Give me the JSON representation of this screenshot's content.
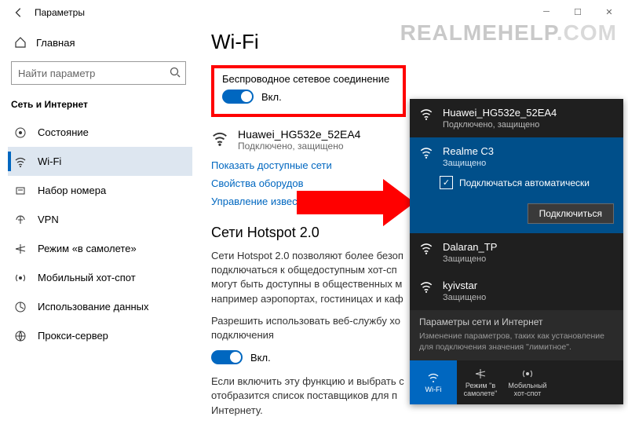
{
  "window": {
    "title": "Параметры"
  },
  "watermark": {
    "a": "REALMEHELP",
    "b": ".COM"
  },
  "sidebar": {
    "home": "Главная",
    "search_placeholder": "Найти параметр",
    "category": "Сеть и Интернет",
    "items": [
      {
        "label": "Состояние"
      },
      {
        "label": "Wi-Fi"
      },
      {
        "label": "Набор номера"
      },
      {
        "label": "VPN"
      },
      {
        "label": "Режим «в самолете»"
      },
      {
        "label": "Мобильный хот-спот"
      },
      {
        "label": "Использование данных"
      },
      {
        "label": "Прокси-сервер"
      }
    ]
  },
  "main": {
    "heading": "Wi-Fi",
    "wireless_label": "Беспроводное сетевое соединение",
    "toggle_state": "Вкл.",
    "current": {
      "name": "Huawei_HG532e_52EA4",
      "status": "Подключено, защищено"
    },
    "links": {
      "show": "Показать доступные сети",
      "props": "Свойства оборудов",
      "manage": "Управление известными сетями"
    },
    "hotspot_heading": "Сети Hotspot 2.0",
    "hotspot_para": "Сети Hotspot 2.0 позволяют более безоп подключаться к общедоступным хот-сп могут быть доступны в общественных м например аэропортах, гостиницах и каф",
    "allow_para": "Разрешить использовать веб-службу хо подключения",
    "toggle2_state": "Вкл.",
    "footer_para": "Если включить эту функцию и выбрать с отобразится список поставщиков для п Интернету."
  },
  "flyout": {
    "nets": [
      {
        "name": "Huawei_HG532e_52EA4",
        "sub": "Подключено, защищено"
      },
      {
        "name": "Realme C3",
        "sub": "Защищено"
      },
      {
        "name": "Dalaran_TP",
        "sub": "Защищено"
      },
      {
        "name": "kyivstar",
        "sub": "Защищено"
      }
    ],
    "auto": "Подключаться автоматически",
    "connect": "Подключиться",
    "section_hd": "Параметры сети и Интернет",
    "section_tx": "Изменение параметров, таких как установление для подключения значения \"лимитное\".",
    "tiles": [
      {
        "label": "Wi-Fi"
      },
      {
        "label": "Режим \"в самолете\""
      },
      {
        "label": "Мобильный хот-спот"
      }
    ]
  }
}
